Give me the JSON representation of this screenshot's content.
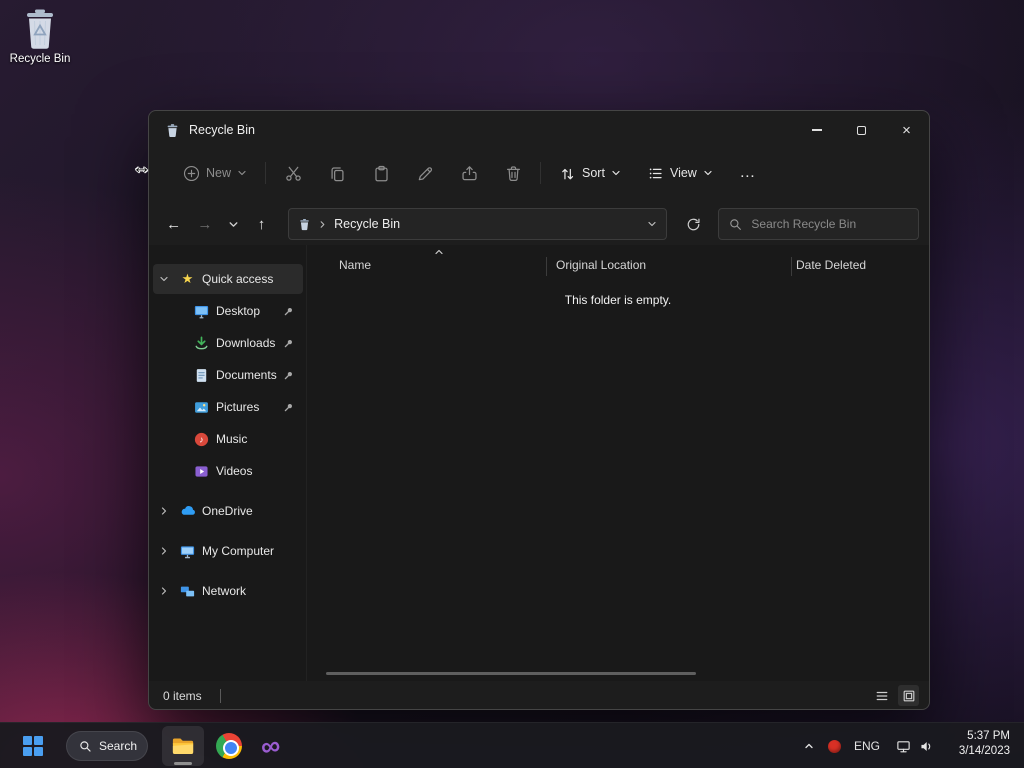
{
  "desktop": {
    "recycle_bin_label": "Recycle Bin"
  },
  "cursor": {
    "glyph": "↔"
  },
  "icons": {
    "close": "×",
    "star": "★",
    "more": "…"
  },
  "window": {
    "title": "Recycle Bin",
    "toolbar": {
      "new": "New",
      "sort": "Sort",
      "view": "View"
    },
    "navbar": {
      "back": "←",
      "forward": "→",
      "up": "↑",
      "location": "Recycle Bin",
      "search_placeholder": "Search Recycle Bin"
    },
    "sidebar": {
      "items": [
        {
          "label": "Quick access"
        },
        {
          "label": "Desktop"
        },
        {
          "label": "Downloads"
        },
        {
          "label": "Documents"
        },
        {
          "label": "Pictures"
        },
        {
          "label": "Music"
        },
        {
          "label": "Videos"
        },
        {
          "label": "OneDrive"
        },
        {
          "label": "My Computer"
        },
        {
          "label": "Network"
        }
      ]
    },
    "content": {
      "columns": [
        "Name",
        "Original Location",
        "Date Deleted"
      ],
      "empty_message": "This folder is empty."
    },
    "statusbar": {
      "items_count": "0 items"
    }
  },
  "taskbar": {
    "search_label": "Search",
    "tray": {
      "language": "ENG",
      "time": "5:37 PM",
      "date": "3/14/2023"
    }
  },
  "colors": {
    "accent_blue": "#4a9ef0",
    "star_yellow": "#f8d64e",
    "downloads_green": "#41b45a",
    "music_red": "#d9483b",
    "videos_purple": "#8a5fd1",
    "onedrive_blue": "#2f9df4",
    "vs_purple": "#9a5cd0",
    "chrome_red": "#ea4335",
    "chrome_yellow": "#fbbc05",
    "chrome_green": "#34a853",
    "chrome_blue": "#4285f4",
    "tray_red": "#d93025"
  }
}
